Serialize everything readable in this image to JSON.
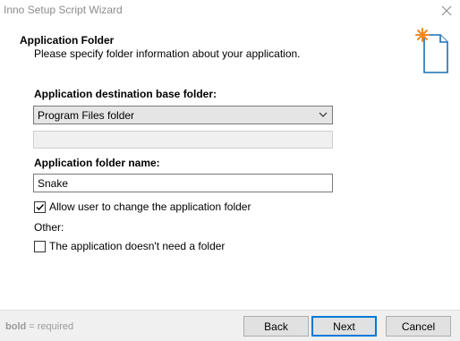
{
  "window": {
    "title": "Inno Setup Script Wizard"
  },
  "header": {
    "title": "Application Folder",
    "subtitle": "Please specify folder information about your application."
  },
  "form": {
    "base_folder_label": "Application destination base folder:",
    "base_folder_value": "Program Files folder",
    "custom_folder_value": "",
    "folder_name_label": "Application folder name:",
    "folder_name_value": "Snake",
    "allow_change_label": "Allow user to change the application folder",
    "allow_change_checked": true,
    "other_label": "Other:",
    "no_folder_label": "The application doesn't need a folder",
    "no_folder_checked": false
  },
  "footer": {
    "hint_bold": "bold",
    "hint_rest": " = required",
    "back_label": "Back",
    "next_label": "Next",
    "cancel_label": "Cancel"
  },
  "icons": {
    "close": "close-icon",
    "wizard": "new-file-sparkle-icon",
    "dropdown": "chevron-down-icon",
    "check": "check-icon"
  },
  "colors": {
    "accent": "#0078d7",
    "sparkle": "#f08a24",
    "title_text": "#8c8c8c"
  }
}
